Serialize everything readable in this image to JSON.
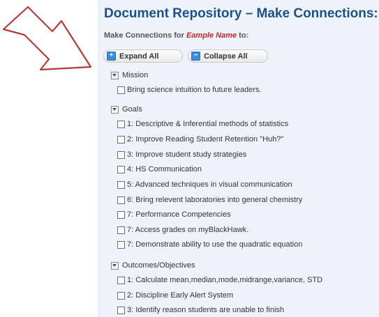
{
  "header": {
    "title": "Document Repository – Make Connections:",
    "subtitle_prefix": "Make Connections for ",
    "subtitle_name": "Eample Name",
    "subtitle_suffix": " to:"
  },
  "actions": {
    "expand_label": "Expand All",
    "collapse_label": "Collapse All"
  },
  "colors": {
    "title": "#1f4f8a",
    "name": "#c0282a",
    "arrow": "#b23a3a"
  },
  "groups": [
    {
      "label": "Mission",
      "items": [
        "Bring science intuition to future leaders."
      ]
    },
    {
      "label": "Goals",
      "items": [
        "1: Descriptive & Inferential methods of statistics",
        "2: Improve Reading Student Retention \"Huh?\"",
        "3: Improve student study strategies",
        "4: HS Communication",
        "5: Advanced techniques in visual communication",
        "6: Bring relevent laboratories into general chemistry",
        "7: Performance Competencies",
        "7: Access grades on myBlackHawk.",
        "7: Demonstrate ability to use the quadratic equation"
      ]
    },
    {
      "label": "Outcomes/Objectives",
      "items": [
        "1: Calculate mean,median,mode,midrange,variance, STD",
        "2: Discipline Early Alert System",
        "3: Identify reason students are unable to finish"
      ]
    }
  ]
}
